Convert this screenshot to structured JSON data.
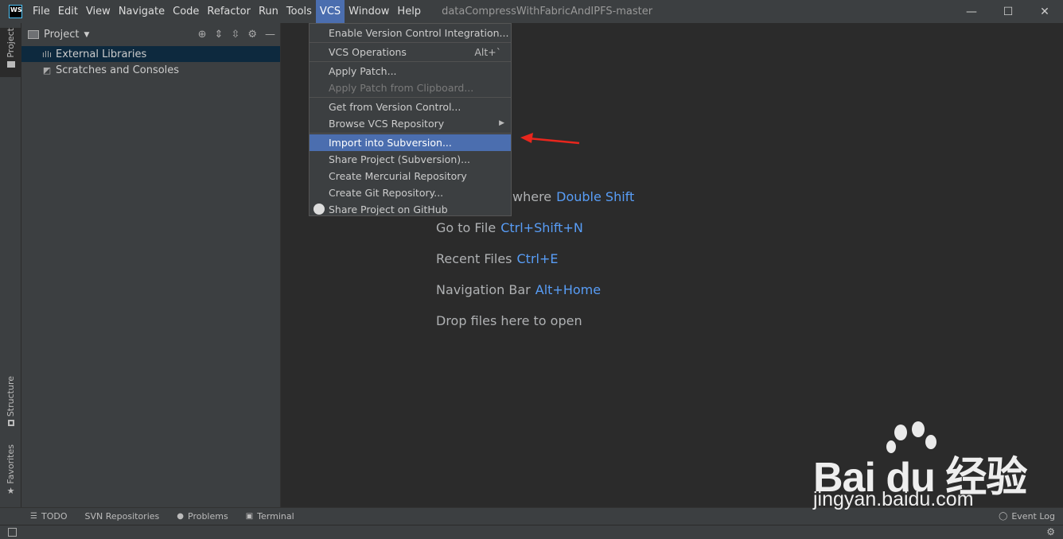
{
  "titlebar": {
    "logo_text": "WS",
    "menus": [
      "File",
      "Edit",
      "View",
      "Navigate",
      "Code",
      "Refactor",
      "Run",
      "Tools",
      "VCS",
      "Window",
      "Help"
    ],
    "active_menu": "VCS",
    "window_title": "dataCompressWithFabricAndIPFS-master",
    "controls": {
      "minimize": "—",
      "maximize": "☐",
      "close": "✕"
    }
  },
  "left_strip": {
    "project_tab": "Project",
    "structure_tab": "Structure",
    "favorites_tab": "Favorites"
  },
  "project_panel": {
    "title": "Project",
    "tree": [
      "External Libraries",
      "Scratches and Consoles"
    ]
  },
  "vcs_menu": {
    "items": [
      {
        "label": "Enable Version Control Integration...",
        "state": "normal"
      },
      {
        "label": "VCS Operations",
        "shortcut": "Alt+`",
        "state": "normal"
      },
      {
        "label": "Apply Patch...",
        "state": "normal"
      },
      {
        "label": "Apply Patch from Clipboard...",
        "state": "disabled"
      },
      {
        "label": "Get from Version Control...",
        "state": "normal"
      },
      {
        "label": "Browse VCS Repository",
        "state": "submenu"
      },
      {
        "label": "Import into Subversion...",
        "state": "highlighted"
      },
      {
        "label": "Share Project (Subversion)...",
        "state": "normal"
      },
      {
        "label": "Create Mercurial Repository",
        "state": "normal"
      },
      {
        "label": "Create Git Repository...",
        "state": "normal"
      },
      {
        "label": "Share Project on GitHub",
        "state": "normal"
      }
    ]
  },
  "editor_hints": [
    {
      "label": "where",
      "key": "Double Shift"
    },
    {
      "label": "Go to File",
      "key": "Ctrl+Shift+N"
    },
    {
      "label": "Recent Files",
      "key": "Ctrl+E"
    },
    {
      "label": "Navigation Bar",
      "key": "Alt+Home"
    },
    {
      "label": "Drop files here to open",
      "key": ""
    }
  ],
  "bottom_bar": {
    "todo": "TODO",
    "svn": "SVN Repositories",
    "problems": "Problems",
    "terminal": "Terminal",
    "event_log": "Event Log"
  },
  "watermark": {
    "brand": "Bai du 经验",
    "url": "jingyan.baidu.com"
  },
  "colors": {
    "accent": "#4b6eaf",
    "shortcut": "#589df6",
    "annotation_arrow": "#e8261d"
  }
}
